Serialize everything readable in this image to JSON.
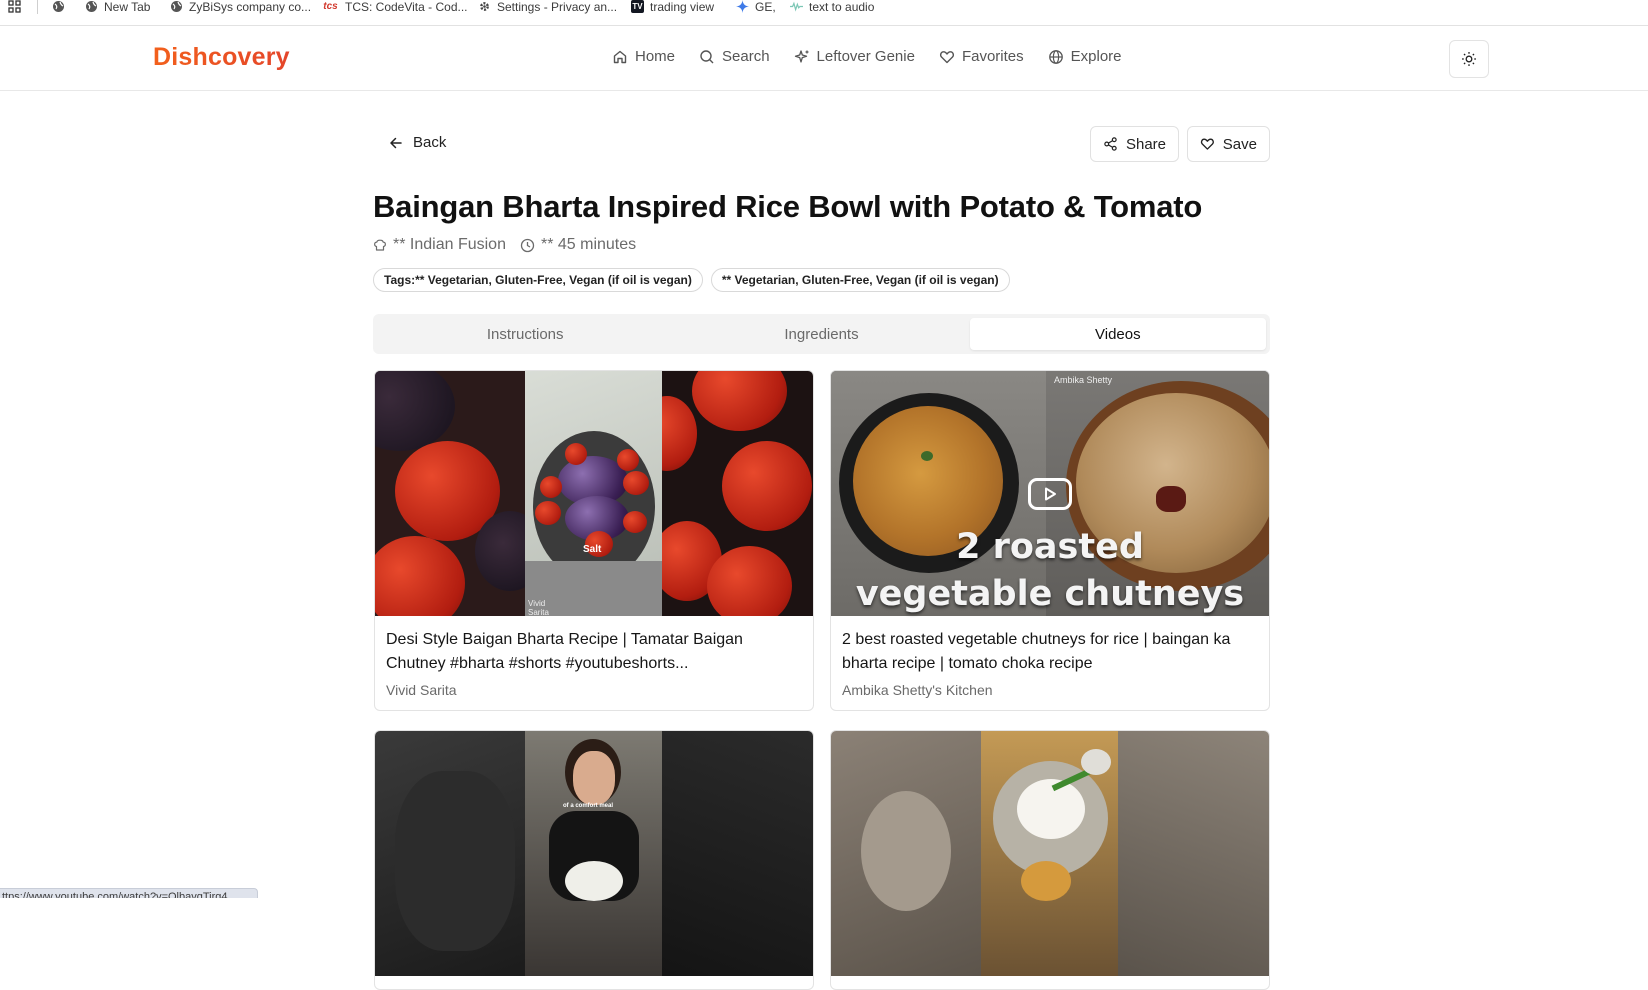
{
  "bookmarks": [
    {
      "label": "",
      "icon": "apps-grid-icon"
    },
    {
      "label": "",
      "icon": "globe-icon"
    },
    {
      "label": "New Tab",
      "icon": "globe-icon"
    },
    {
      "label": "ZyBiSys company co...",
      "icon": "globe-icon"
    },
    {
      "label": "TCS: CodeVita - Cod...",
      "icon": "tcs-logo-icon"
    },
    {
      "label": "Settings - Privacy an...",
      "icon": "gear-icon"
    },
    {
      "label": "trading view",
      "icon": "tradingview-logo-icon"
    },
    {
      "label": "GE,",
      "icon": "gemini-sparkle-icon"
    },
    {
      "label": "text to audio",
      "icon": "audio-wave-icon"
    }
  ],
  "app": {
    "name": "Dishcovery"
  },
  "nav": {
    "home": "Home",
    "search": "Search",
    "leftover": "Leftover Genie",
    "favorites": "Favorites",
    "explore": "Explore"
  },
  "actions": {
    "back": "Back",
    "share": "Share",
    "save": "Save"
  },
  "recipe": {
    "title": "Baingan Bharta Inspired Rice Bowl with Potato & Tomato",
    "cuisine": "** Indian Fusion",
    "time": "** 45 minutes",
    "tags": [
      "Tags:** Vegetarian, Gluten-Free, Vegan (if oil is vegan)",
      "** Vegetarian, Gluten-Free, Vegan (if oil is vegan)"
    ]
  },
  "tabs": [
    {
      "label": "Instructions",
      "active": false
    },
    {
      "label": "Ingredients",
      "active": false
    },
    {
      "label": "Videos",
      "active": true
    }
  ],
  "videos": [
    {
      "title": "Desi Style Baigan Bharta Recipe | Tamatar Baigan Chutney #bharta #shorts #youtubeshorts...",
      "channel": "Vivid Sarita",
      "overlay_small": "Salt",
      "overlay_credit": "Vivid Sarita"
    },
    {
      "title": "2 best roasted vegetable chutneys for rice | baingan ka bharta recipe | tomato choka recipe",
      "channel": "Ambika Shetty's Kitchen",
      "overlay_credit": "Ambika Shetty",
      "overlay_line1": "2 roasted",
      "overlay_line2": "vegetable chutneys"
    },
    {
      "title": "",
      "channel": "",
      "overlay_small": "of a comfort meal"
    },
    {
      "title": "",
      "channel": ""
    }
  ],
  "status_url": "ttps://www.youtube.com/watch?v=OlbavgTirg4",
  "colors": {
    "brand_start": "#f2601c",
    "brand_end": "#e4452a"
  }
}
